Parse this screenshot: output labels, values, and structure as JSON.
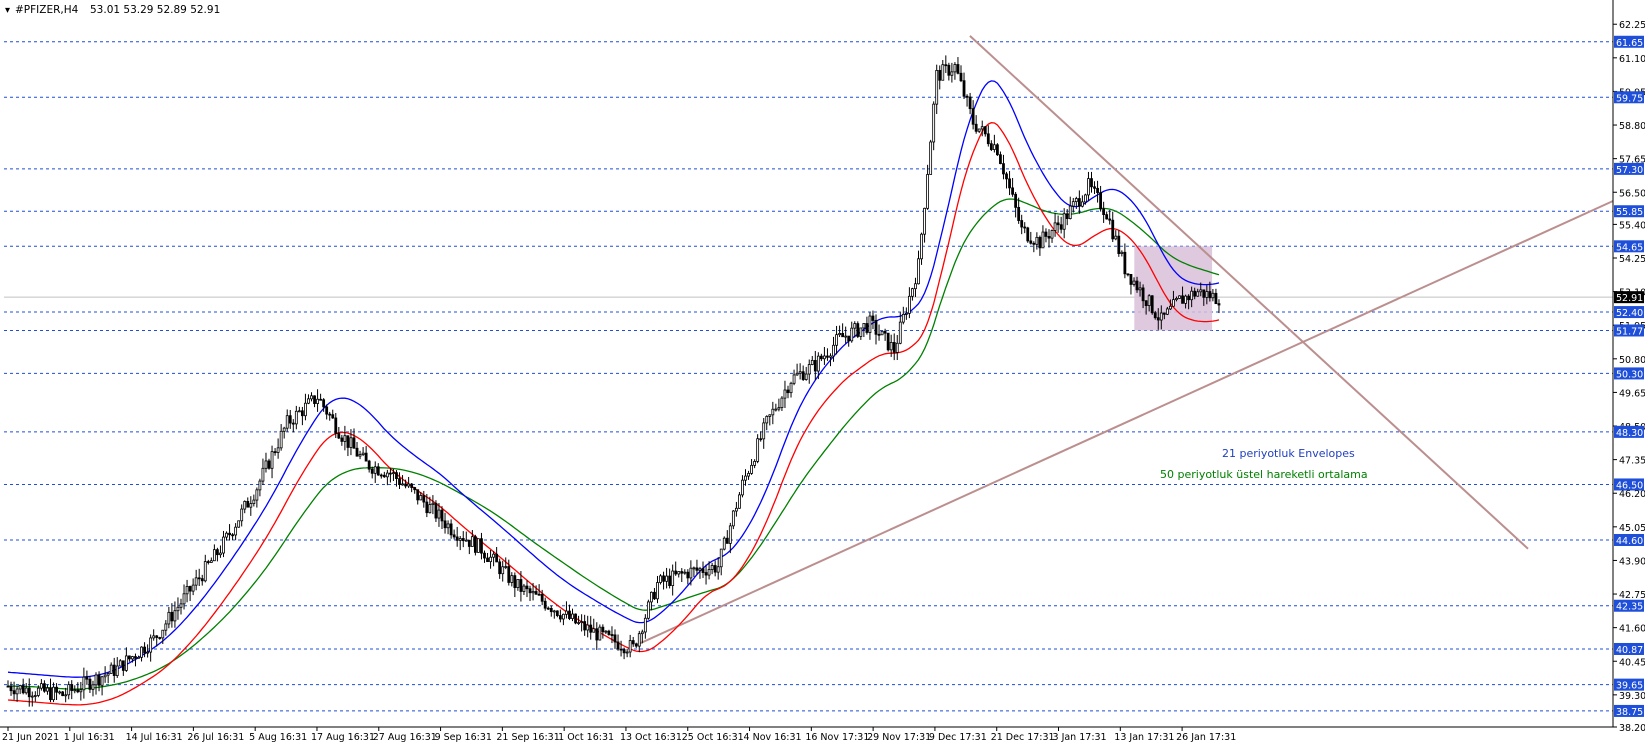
{
  "header": {
    "symbol": "#PFIZER,H4",
    "ohlc": "53.01 53.29 52.89 52.91"
  },
  "annotations": {
    "envelopes_label": "21 periyotluk Envelopes",
    "ema_label": "50 periyotluk üstel hareketli ortalama"
  },
  "colors": {
    "upper_envelope": "#0000ff",
    "lower_envelope": "#ff0000",
    "ema50": "#008000",
    "trendline": "#bc8f8f",
    "level_line": "#1f4fd8",
    "consolidation_box": "#d8bfd8",
    "candle": "#000000",
    "current_price_line": "#c0c0c0"
  },
  "chart_data": {
    "type": "candlestick",
    "x_ticks": [
      "21 Jun 2021",
      "1 Jul 16:31",
      "14 Jul 16:31",
      "26 Jul 16:31",
      "5 Aug 16:31",
      "17 Aug 16:31",
      "27 Aug 16:31",
      "9 Sep 16:31",
      "21 Sep 16:31",
      "1 Oct 16:31",
      "13 Oct 16:31",
      "25 Oct 16:31",
      "4 Nov 16:31",
      "16 Nov 17:31",
      "29 Nov 17:31",
      "9 Dec 17:31",
      "21 Dec 17:31",
      "3 Jan 17:31",
      "13 Jan 17:31",
      "26 Jan 17:31"
    ],
    "y_ticks": [
      62.25,
      61.1,
      59.95,
      58.8,
      57.65,
      56.5,
      55.4,
      54.25,
      53.1,
      51.95,
      50.8,
      49.65,
      48.5,
      47.35,
      46.2,
      45.05,
      43.9,
      42.75,
      41.6,
      40.45,
      39.3,
      38.2
    ],
    "ylim": [
      38.2,
      62.6
    ],
    "horizontal_levels": [
      61.65,
      59.75,
      57.3,
      55.85,
      54.65,
      52.4,
      51.77,
      50.3,
      48.3,
      46.5,
      44.6,
      42.35,
      40.87,
      39.65,
      38.75
    ],
    "current_price": 52.91,
    "trendlines": [
      {
        "name": "descending",
        "from": [
          "9 Dec 17:31",
          61.85
        ],
        "to": [
          "end",
          44.3
        ]
      },
      {
        "name": "ascending",
        "from": [
          "13 Oct 16:31",
          41.0
        ],
        "to": [
          "end",
          56.2
        ]
      }
    ],
    "consolidation_box": {
      "from": "13 Jan 17:31",
      "to": "26 Jan 17:31",
      "top": 54.65,
      "bottom": 51.77
    },
    "close_path": [
      [
        0,
        39.6
      ],
      [
        18,
        39.3
      ],
      [
        24,
        39.6
      ],
      [
        36,
        40.2
      ],
      [
        48,
        41.2
      ],
      [
        58,
        42.6
      ],
      [
        70,
        44.3
      ],
      [
        82,
        46.4
      ],
      [
        92,
        48.6
      ],
      [
        102,
        49.5
      ],
      [
        110,
        48.2
      ],
      [
        118,
        47.2
      ],
      [
        126,
        46.9
      ],
      [
        136,
        46.0
      ],
      [
        146,
        45.0
      ],
      [
        156,
        44.3
      ],
      [
        168,
        43.0
      ],
      [
        178,
        42.4
      ],
      [
        188,
        41.7
      ],
      [
        198,
        41.2
      ],
      [
        206,
        40.9
      ],
      [
        214,
        43.1
      ],
      [
        224,
        43.5
      ],
      [
        234,
        43.7
      ],
      [
        242,
        46.5
      ],
      [
        250,
        48.6
      ],
      [
        258,
        50.1
      ],
      [
        266,
        50.6
      ],
      [
        274,
        51.5
      ],
      [
        284,
        52.0
      ],
      [
        292,
        51.1
      ],
      [
        300,
        54.0
      ],
      [
        306,
        60.5
      ],
      [
        312,
        60.8
      ],
      [
        318,
        58.9
      ],
      [
        326,
        58.0
      ],
      [
        334,
        55.2
      ],
      [
        340,
        54.8
      ],
      [
        348,
        55.6
      ],
      [
        356,
        56.7
      ],
      [
        362,
        55.8
      ],
      [
        368,
        53.9
      ],
      [
        374,
        53.0
      ],
      [
        380,
        52.1
      ],
      [
        386,
        52.8
      ],
      [
        392,
        53.1
      ],
      [
        398,
        52.9
      ]
    ],
    "series": [
      {
        "name": "21 periyotluk Envelopes",
        "color": "#0000ff"
      },
      {
        "name": "21 periyotluk Envelopes",
        "color": "#ff0000"
      },
      {
        "name": "50 periyotluk üstel hareketli ortalama",
        "color": "#008000"
      }
    ]
  }
}
